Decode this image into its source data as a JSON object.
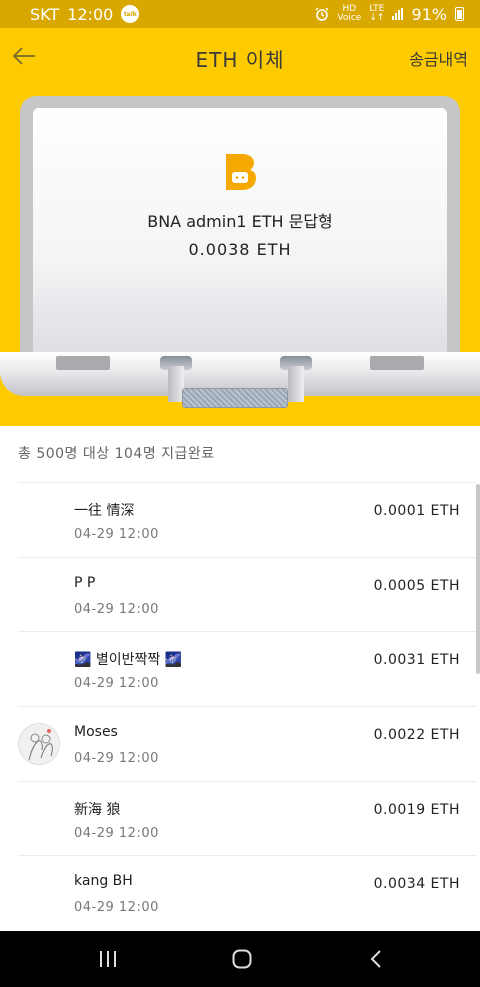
{
  "status_bar": {
    "carrier": "SKT",
    "time": "12:00",
    "talk_badge": "talk",
    "hd_label": "HD",
    "voice_label": "Voice",
    "network": "LTE",
    "battery": "91%"
  },
  "header": {
    "title": "ETH 이체",
    "history_link": "송금내역"
  },
  "transfer": {
    "name": "BNA admin1 ETH 문답형",
    "amount": "0.0038 ETH"
  },
  "summary": "총 500명 대상 104명 지급완료",
  "recipients": [
    {
      "name": "一往 情深",
      "time": "04-29 12:00",
      "amount": "0.0001 ETH",
      "has_avatar": false
    },
    {
      "name": "P P",
      "time": "04-29 12:00",
      "amount": "0.0005 ETH",
      "has_avatar": false
    },
    {
      "name": "🌌 별이반짝짝 🌌",
      "time": "04-29 12:00",
      "amount": "0.0031 ETH",
      "has_avatar": false
    },
    {
      "name": "Moses",
      "time": "04-29 12:00",
      "amount": "0.0022 ETH",
      "has_avatar": true
    },
    {
      "name": "新海 狼",
      "time": "04-29 12:00",
      "amount": "0.0019 ETH",
      "has_avatar": false
    },
    {
      "name": "kang BH",
      "time": "04-29 12:00",
      "amount": "0.0034 ETH",
      "has_avatar": false
    }
  ],
  "colors": {
    "brand_yellow": "#fecb00",
    "status_bar": "#d9a800",
    "logo_orange": "#f5a800"
  },
  "icons": {
    "back": "back-arrow-icon",
    "logo": "bna-logo-icon",
    "nav_recent": "recent-apps-icon",
    "nav_home": "home-icon",
    "nav_back": "back-icon"
  }
}
